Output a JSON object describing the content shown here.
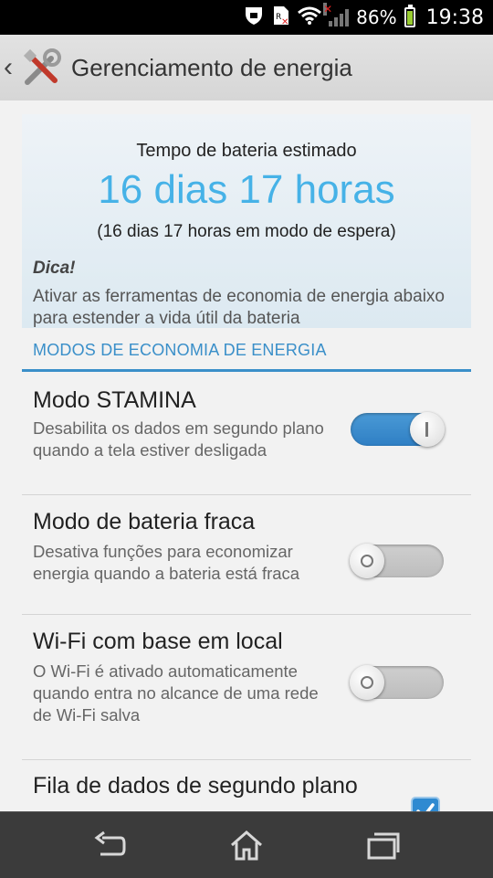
{
  "status_bar": {
    "battery_percent": "86%",
    "time": "19:38",
    "battery_level": 0.86,
    "icons": [
      "security-icon",
      "sim-icon",
      "wifi-icon",
      "signal-icon",
      "battery-icon"
    ]
  },
  "action_bar": {
    "title": "Gerenciamento de energia",
    "icon": "tools-icon"
  },
  "info_card": {
    "label": "Tempo de bateria estimado",
    "value": "16 dias 17 horas",
    "sub": "(16 dias 17 horas em modo de espera)",
    "tip_title": "Dica!",
    "tip_text": "Ativar as ferramentas de economia de energia abaixo para estender a vida útil da bateria"
  },
  "section": {
    "header": "MODOS DE ECONOMIA DE ENERGIA"
  },
  "settings": [
    {
      "title": "Modo STAMINA",
      "description": "Desabilita os dados em segundo plano quando a tela estiver desligada",
      "control": "toggle",
      "enabled": true
    },
    {
      "title": "Modo de bateria fraca",
      "description": "Desativa funções para economizar energia quando a bateria está fraca",
      "control": "toggle",
      "enabled": false
    },
    {
      "title": "Wi-Fi com base em local",
      "description": "O Wi-Fi é ativado automaticamente quando entra no alcance de uma rede de Wi-Fi salva",
      "control": "toggle",
      "enabled": false
    },
    {
      "title": "Fila de dados de segundo plano",
      "control": "checkbox",
      "checked": true
    }
  ],
  "nav_bar": {
    "icons": [
      "back-icon",
      "home-icon",
      "recent-apps-icon"
    ]
  },
  "colors": {
    "accent": "#3a8fc9",
    "estimate_value": "#46b2e7",
    "toggle_on": "#2f7fc4",
    "toggle_off": "#c4c4c4"
  }
}
